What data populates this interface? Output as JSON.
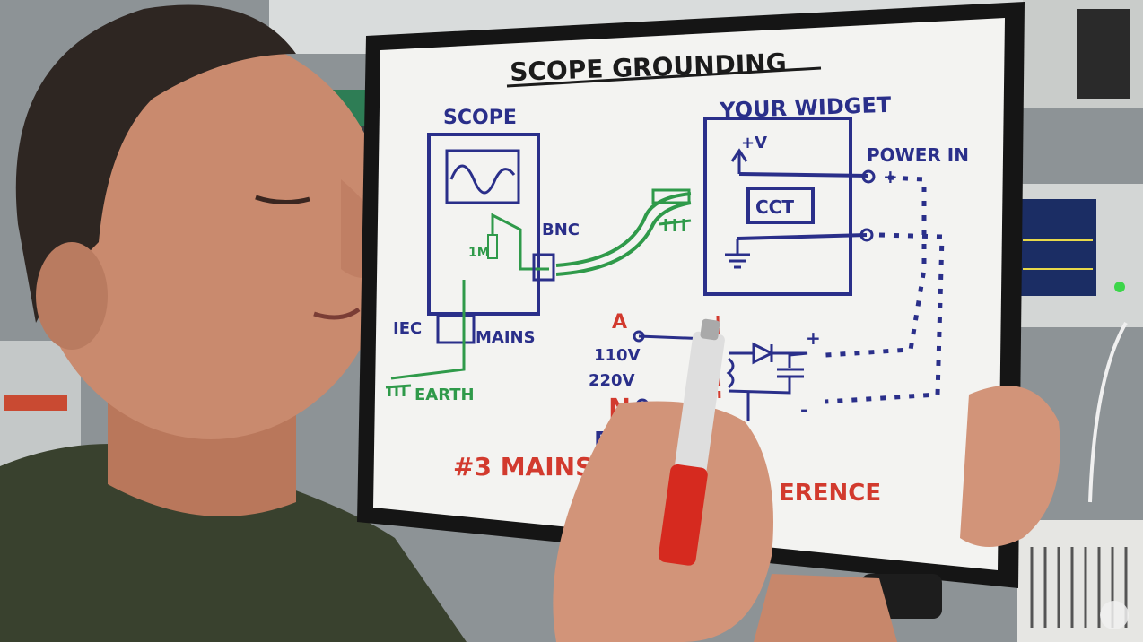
{
  "whiteboard": {
    "title": "SCOPE GROUNDING",
    "scope_label": "SCOPE",
    "widget_label": "YOUR WIDGET",
    "plus_v": "+V",
    "cct": "CCT",
    "power_in": "POWER IN",
    "bnc": "BNC",
    "one_meg": "1M",
    "iec": "IEC",
    "mains": "MAINS",
    "earth": "EARTH",
    "active": "A",
    "v110": "110V",
    "v220": "220V",
    "neutral": "N",
    "earth_letter": "E",
    "bottom_note_left": "#3 MAINS",
    "bottom_note_right": "ERENCE",
    "plus_sign": "+",
    "minus_sign": "-"
  },
  "colors": {
    "ink_blue": "#2a2f8a",
    "ink_green": "#2f9a4a",
    "ink_red": "#d23a2e",
    "board": "#f3f3f1",
    "frame": "#151515",
    "shirt": "#39412e",
    "skin": "#c98a6e"
  }
}
